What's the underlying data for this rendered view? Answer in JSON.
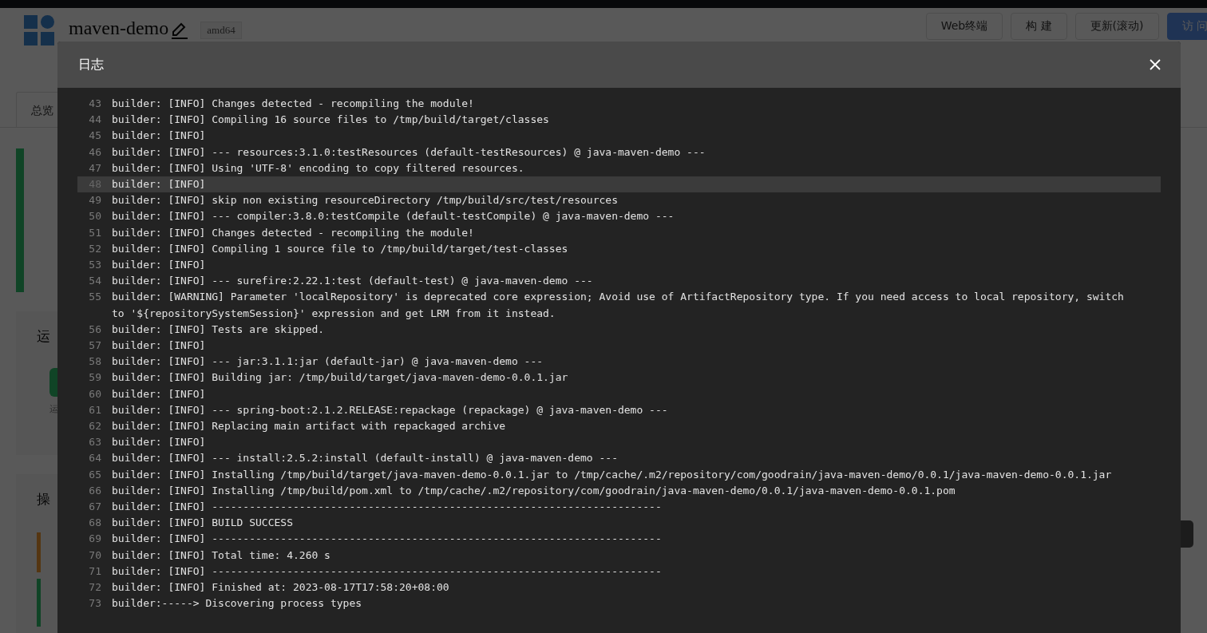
{
  "app_header": {
    "title": "maven-demo",
    "arch_tag": "amd64",
    "buttons": [
      {
        "label": "Web终端",
        "kind": "default"
      },
      {
        "label": "构 建",
        "kind": "default"
      },
      {
        "label": "更新(滚动)",
        "kind": "default"
      },
      {
        "label": "访 问",
        "kind": "primary"
      }
    ]
  },
  "tabs": [
    {
      "label": "总览",
      "selected": true
    }
  ],
  "sections": [
    {
      "title": "运",
      "caption": "运"
    },
    {
      "title": "操"
    }
  ],
  "log_dialog": {
    "title": "日志",
    "lines": [
      {
        "number": "43",
        "text": "builder: [INFO] Changes detected - recompiling the module!",
        "selected": false
      },
      {
        "number": "44",
        "text": "builder: [INFO] Compiling 16 source files to /tmp/build/target/classes",
        "selected": false
      },
      {
        "number": "45",
        "text": "builder: [INFO]",
        "selected": false
      },
      {
        "number": "46",
        "text": "builder: [INFO] --- resources:3.1.0:testResources (default-testResources) @ java-maven-demo ---",
        "selected": false
      },
      {
        "number": "47",
        "text": "builder: [INFO] Using 'UTF-8' encoding to copy filtered resources.",
        "selected": false
      },
      {
        "number": "48",
        "text": "builder: [INFO]",
        "selected": true
      },
      {
        "number": "49",
        "text": "builder: [INFO] skip non existing resourceDirectory /tmp/build/src/test/resources",
        "selected": false
      },
      {
        "number": "50",
        "text": "builder: [INFO] --- compiler:3.8.0:testCompile (default-testCompile) @ java-maven-demo ---",
        "selected": false
      },
      {
        "number": "51",
        "text": "builder: [INFO] Changes detected - recompiling the module!",
        "selected": false
      },
      {
        "number": "52",
        "text": "builder: [INFO] Compiling 1 source file to /tmp/build/target/test-classes",
        "selected": false
      },
      {
        "number": "53",
        "text": "builder: [INFO]",
        "selected": false
      },
      {
        "number": "54",
        "text": "builder: [INFO] --- surefire:2.22.1:test (default-test) @ java-maven-demo ---",
        "selected": false
      },
      {
        "number": "55",
        "text": "builder: [WARNING] Parameter 'localRepository' is deprecated core expression; Avoid use of ArtifactRepository type. If you need access to local repository, switch to '${repositorySystemSession}' expression and get LRM from it instead.",
        "selected": false
      },
      {
        "number": "56",
        "text": "builder: [INFO] Tests are skipped.",
        "selected": false
      },
      {
        "number": "57",
        "text": "builder: [INFO]",
        "selected": false
      },
      {
        "number": "58",
        "text": "builder: [INFO] --- jar:3.1.1:jar (default-jar) @ java-maven-demo ---",
        "selected": false
      },
      {
        "number": "59",
        "text": "builder: [INFO] Building jar: /tmp/build/target/java-maven-demo-0.0.1.jar",
        "selected": false
      },
      {
        "number": "60",
        "text": "builder: [INFO]",
        "selected": false
      },
      {
        "number": "61",
        "text": "builder: [INFO] --- spring-boot:2.1.2.RELEASE:repackage (repackage) @ java-maven-demo ---",
        "selected": false
      },
      {
        "number": "62",
        "text": "builder: [INFO] Replacing main artifact with repackaged archive",
        "selected": false
      },
      {
        "number": "63",
        "text": "builder: [INFO]",
        "selected": false
      },
      {
        "number": "64",
        "text": "builder: [INFO] --- install:2.5.2:install (default-install) @ java-maven-demo ---",
        "selected": false
      },
      {
        "number": "65",
        "text": "builder: [INFO] Installing /tmp/build/target/java-maven-demo-0.0.1.jar to /tmp/cache/.m2/repository/com/goodrain/java-maven-demo/0.0.1/java-maven-demo-0.0.1.jar",
        "selected": false
      },
      {
        "number": "66",
        "text": "builder: [INFO] Installing /tmp/build/pom.xml to /tmp/cache/.m2/repository/com/goodrain/java-maven-demo/0.0.1/java-maven-demo-0.0.1.pom",
        "selected": false
      },
      {
        "number": "67",
        "text": "builder: [INFO] ------------------------------------------------------------------------",
        "selected": false
      },
      {
        "number": "68",
        "text": "builder: [INFO] BUILD SUCCESS",
        "selected": false
      },
      {
        "number": "69",
        "text": "builder: [INFO] ------------------------------------------------------------------------",
        "selected": false
      },
      {
        "number": "70",
        "text": "builder: [INFO] Total time: 4.260 s",
        "selected": false
      },
      {
        "number": "71",
        "text": "builder: [INFO] ------------------------------------------------------------------------",
        "selected": false
      },
      {
        "number": "72",
        "text": "builder: [INFO] Finished at: 2023-08-17T17:58:20+08:00",
        "selected": false
      },
      {
        "number": "73",
        "text": "builder:-----> Discovering process types",
        "selected": false
      }
    ]
  }
}
